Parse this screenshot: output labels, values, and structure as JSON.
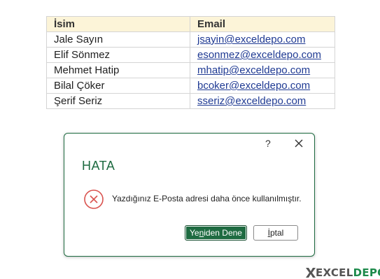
{
  "table": {
    "headers": {
      "name": "İsim",
      "email": "Email"
    },
    "rows": [
      {
        "name": "Jale Sayın",
        "email": "jsayin@exceldepo.com"
      },
      {
        "name": "Elif Sönmez",
        "email": "esonmez@exceldepo.com"
      },
      {
        "name": "Mehmet Hatip",
        "email": "mhatip@exceldepo.com"
      },
      {
        "name": "Bilal Çöker",
        "email": "bcoker@exceldepo.com"
      },
      {
        "name": "Şerif Seriz",
        "email": "sseriz@exceldepo.com"
      }
    ]
  },
  "dialog": {
    "help_label": "?",
    "title": "HATA",
    "message": "Yazdığınız E-Posta adresi daha önce kullanılmıştır.",
    "retry_button": {
      "before": "Ye",
      "accel": "n",
      "after": "iden Dene"
    },
    "cancel_button": {
      "accel": "İ",
      "after": "ptal"
    },
    "accent_color": "#1e6b41",
    "error_color": "#d9534f"
  },
  "logo": {
    "text_part1": "EXCEL",
    "text_part2": "DEPO"
  }
}
